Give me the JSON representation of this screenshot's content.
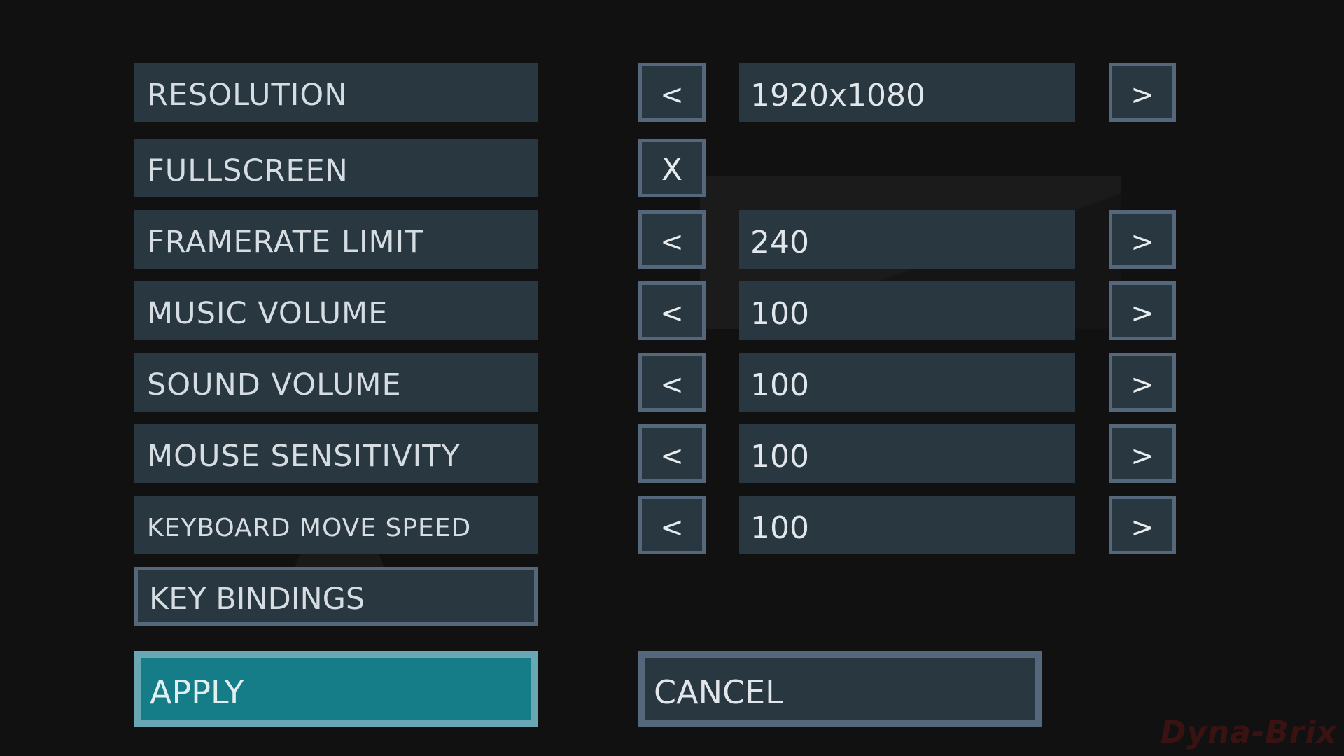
{
  "settings": {
    "resolution": {
      "label": "RESOLUTION",
      "value": "1920x1080"
    },
    "fullscreen": {
      "label": "FULLSCREEN",
      "checkbox_mark": "X"
    },
    "framerate_limit": {
      "label": "FRAMERATE LIMIT",
      "value": "240"
    },
    "music_volume": {
      "label": "MUSIC VOLUME",
      "value": "100"
    },
    "sound_volume": {
      "label": "SOUND VOLUME",
      "value": "100"
    },
    "mouse_sensitivity": {
      "label": "MOUSE SENSITIVITY",
      "value": "100"
    },
    "keyboard_move_speed": {
      "label": "KEYBOARD MOVE SPEED",
      "value": "100"
    }
  },
  "arrows": {
    "prev": "<",
    "next": ">"
  },
  "buttons": {
    "key_bindings": "KEY BINDINGS",
    "apply": "APPLY",
    "cancel": "CANCEL"
  },
  "watermark": "Dyna-Brix",
  "colors": {
    "background": "#121111",
    "panel": "#293740",
    "border": "#55677a",
    "apply_fill": "#147d87",
    "apply_border": "#6aa7b4",
    "text": "#d6dde2",
    "watermark": "#3a1212"
  }
}
